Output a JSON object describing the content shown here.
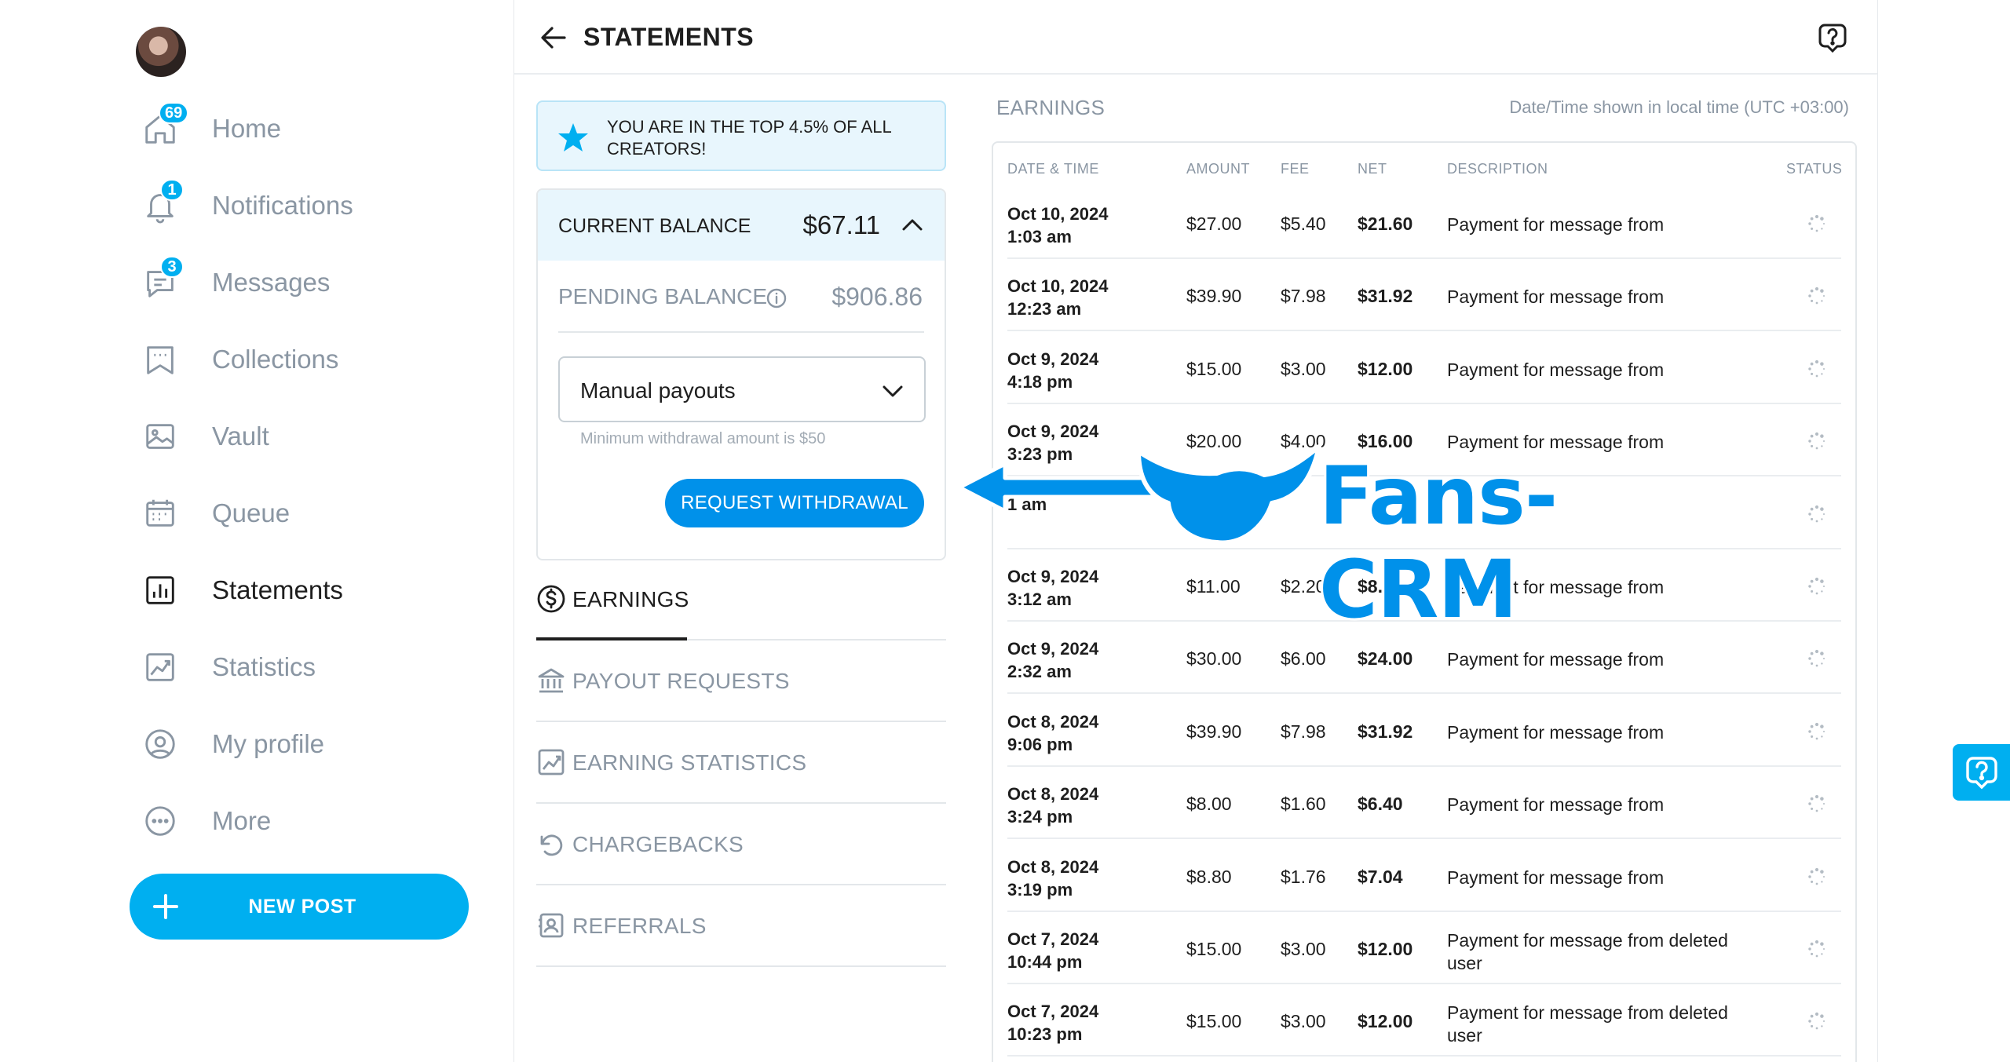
{
  "sidebar": {
    "avatar_alt": "",
    "items": [
      {
        "label": "Home",
        "badge": "69"
      },
      {
        "label": "Notifications",
        "badge": "1"
      },
      {
        "label": "Messages",
        "badge": "3"
      },
      {
        "label": "Collections",
        "badge": ""
      },
      {
        "label": "Vault",
        "badge": ""
      },
      {
        "label": "Queue",
        "badge": ""
      },
      {
        "label": "Statements",
        "badge": ""
      },
      {
        "label": "Statistics",
        "badge": ""
      },
      {
        "label": "My profile",
        "badge": ""
      },
      {
        "label": "More",
        "badge": ""
      }
    ],
    "new_post_label": "NEW POST"
  },
  "header": {
    "title": "STATEMENTS"
  },
  "banner": {
    "text": "YOU ARE IN THE TOP 4.5% OF ALL CREATORS!"
  },
  "balance": {
    "current_label": "CURRENT BALANCE",
    "current_value": "$67.11",
    "pending_label": "PENDING BALANCE",
    "pending_value": "$906.86",
    "payout_mode": "Manual payouts",
    "min_note": "Minimum withdrawal amount is $50",
    "withdraw_label": "REQUEST WITHDRAWAL"
  },
  "tabs": [
    {
      "label": "EARNINGS",
      "icon": "dollar-circle-icon"
    },
    {
      "label": "PAYOUT REQUESTS",
      "icon": "bank-icon"
    },
    {
      "label": "EARNING STATISTICS",
      "icon": "chart-icon"
    },
    {
      "label": "CHARGEBACKS",
      "icon": "undo-icon"
    },
    {
      "label": "REFERRALS",
      "icon": "contact-icon"
    }
  ],
  "earnings": {
    "title": "EARNINGS",
    "timezone_note": "Date/Time shown in local time (UTC +03:00)",
    "columns": [
      "DATE & TIME",
      "AMOUNT",
      "FEE",
      "NET",
      "DESCRIPTION",
      "STATUS"
    ],
    "rows": [
      {
        "date": "Oct 10, 2024",
        "time": "1:03 am",
        "amount": "$27.00",
        "fee": "$5.40",
        "net": "$21.60",
        "desc": "Payment for message from"
      },
      {
        "date": "Oct 10, 2024",
        "time": "12:23 am",
        "amount": "$39.90",
        "fee": "$7.98",
        "net": "$31.92",
        "desc": "Payment for message from"
      },
      {
        "date": "Oct 9, 2024",
        "time": "4:18 pm",
        "amount": "$15.00",
        "fee": "$3.00",
        "net": "$12.00",
        "desc": "Payment for message from"
      },
      {
        "date": "Oct 9, 2024",
        "time": "3:23 pm",
        "amount": "$20.00",
        "fee": "$4.00",
        "net": "$16.00",
        "desc": "Payment for message from"
      },
      {
        "date": "",
        "time": "1 am",
        "amount": "",
        "fee": "",
        "net": "",
        "desc": ""
      },
      {
        "date": "Oct 9, 2024",
        "time": "3:12 am",
        "amount": "$11.00",
        "fee": "$2.20",
        "net": "$8.80",
        "desc": "Payment for message from"
      },
      {
        "date": "Oct 9, 2024",
        "time": "2:32 am",
        "amount": "$30.00",
        "fee": "$6.00",
        "net": "$24.00",
        "desc": "Payment for message from"
      },
      {
        "date": "Oct 8, 2024",
        "time": "9:06 pm",
        "amount": "$39.90",
        "fee": "$7.98",
        "net": "$31.92",
        "desc": "Payment for message from"
      },
      {
        "date": "Oct 8, 2024",
        "time": "3:24 pm",
        "amount": "$8.00",
        "fee": "$1.60",
        "net": "$6.40",
        "desc": "Payment for message from"
      },
      {
        "date": "Oct 8, 2024",
        "time": "3:19 pm",
        "amount": "$8.80",
        "fee": "$1.76",
        "net": "$7.04",
        "desc": "Payment for message from"
      },
      {
        "date": "Oct 7, 2024",
        "time": "10:44 pm",
        "amount": "$15.00",
        "fee": "$3.00",
        "net": "$12.00",
        "desc": "Payment for message from deleted user"
      },
      {
        "date": "Oct 7, 2024",
        "time": "10:23 pm",
        "amount": "$15.00",
        "fee": "$3.00",
        "net": "$12.00",
        "desc": "Payment for message from deleted user"
      }
    ]
  },
  "watermark": {
    "text": "Fans-CRM"
  },
  "colors": {
    "accent": "#00aff0",
    "button": "#0091ea",
    "muted": "#8a96a3"
  }
}
